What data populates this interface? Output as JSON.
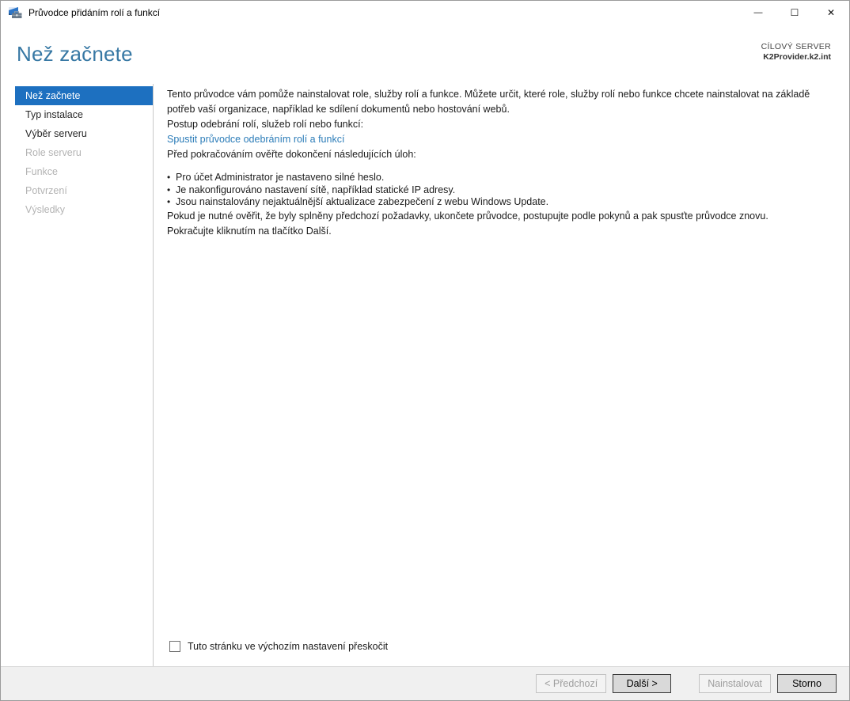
{
  "window": {
    "title": "Průvodce přidáním rolí a funkcí"
  },
  "glyphs": {
    "minimize": "—",
    "maximize": "☐",
    "close": "✕",
    "bullet": "•"
  },
  "header": {
    "title": "Než začnete",
    "target_server_label": "CÍLOVÝ SERVER",
    "target_server_name": "K2Provider.k2.int"
  },
  "sidebar": {
    "items": [
      {
        "label": "Než začnete",
        "state": "selected"
      },
      {
        "label": "Typ instalace",
        "state": "enabled"
      },
      {
        "label": "Výběr serveru",
        "state": "enabled"
      },
      {
        "label": "Role serveru",
        "state": "disabled"
      },
      {
        "label": "Funkce",
        "state": "disabled"
      },
      {
        "label": "Potvrzení",
        "state": "disabled"
      },
      {
        "label": "Výsledky",
        "state": "disabled"
      }
    ]
  },
  "content": {
    "intro": "Tento průvodce vám pomůže nainstalovat role, služby rolí a funkce. Můžete určit, které role, služby rolí nebo funkce chcete nainstalovat na základě potřeb vaší organizace, například ke sdílení dokumentů nebo hostování webů.",
    "remove_label": "Postup odebrání rolí, služeb rolí nebo funkcí:",
    "remove_link": "Spustit průvodce odebráním rolí a funkcí",
    "tasks_heading": "Před pokračováním ověřte dokončení následujících úloh:",
    "tasks": [
      "Pro účet Administrator je nastaveno silné heslo.",
      "Je nakonfigurováno nastavení sítě, například statické IP adresy.",
      "Jsou nainstalovány nejaktuálnější aktualizace zabezpečení z webu Windows Update."
    ],
    "note": "Pokud je nutné ověřit, že byly splněny předchozí požadavky, ukončete průvodce, postupujte podle pokynů a pak spusťte průvodce znovu.",
    "continue_hint": "Pokračujte kliknutím na tlačítko Další.",
    "skip_checkbox_label": "Tuto stránku ve výchozím nastavení přeskočit",
    "skip_checkbox_checked": false
  },
  "footer": {
    "buttons": [
      {
        "label": "< Předchozí",
        "enabled": false,
        "default": false
      },
      {
        "label": "Další >",
        "enabled": true,
        "default": true
      },
      {
        "label": "Nainstalovat",
        "enabled": false,
        "default": false
      },
      {
        "label": "Storno",
        "enabled": true,
        "default": false
      }
    ]
  },
  "colors": {
    "accent": "#1d70c0",
    "header_title": "#3778a4",
    "link": "#2b7cb8",
    "footer_bg": "#f0f0f0",
    "disabled_text": "#b3b3b3"
  }
}
